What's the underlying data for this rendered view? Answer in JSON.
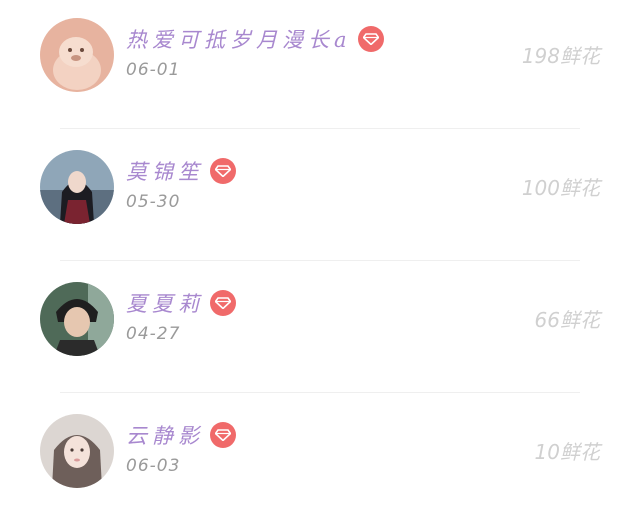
{
  "rows": [
    {
      "name": "热爱可抵岁月漫长a",
      "date": "06-01",
      "flowers": "198鲜花",
      "avatar": "avatar-capybara",
      "badge": "diamond-icon"
    },
    {
      "name": "莫锦笙",
      "date": "05-30",
      "flowers": "100鲜花",
      "avatar": "avatar-girl-lake",
      "badge": "diamond-icon"
    },
    {
      "name": "夏夏莉",
      "date": "04-27",
      "flowers": "66鲜花",
      "avatar": "avatar-boy",
      "badge": "diamond-icon"
    },
    {
      "name": "云静影",
      "date": "06-03",
      "flowers": "10鲜花",
      "avatar": "avatar-girl-drawn",
      "badge": "diamond-icon"
    }
  ],
  "colors": {
    "name": "#a888cf",
    "badge": "#f06a6a",
    "date": "#9a9a9a",
    "flowers": "#d0d0d0"
  }
}
